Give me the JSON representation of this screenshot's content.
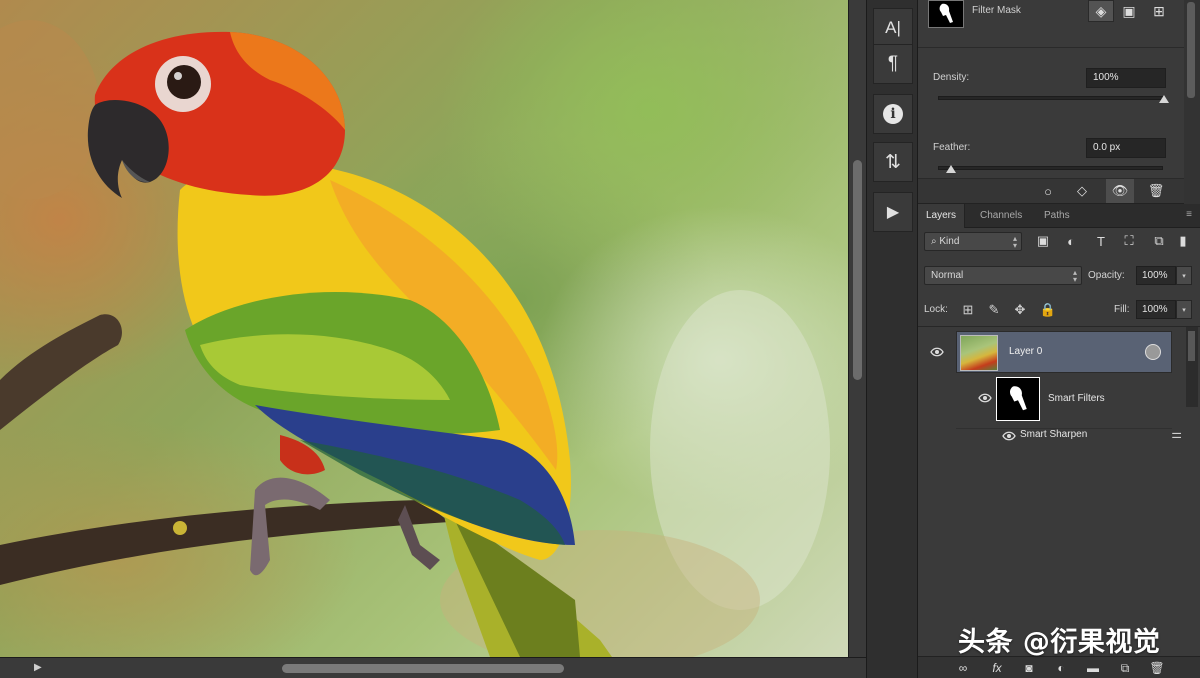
{
  "canvas": {
    "vertical_scroll": "scrollbar",
    "horizontal_scroll_arrow": "▶"
  },
  "toolstrip": {
    "tools": [
      {
        "name": "character-icon",
        "glyph": "A|"
      },
      {
        "name": "paragraph-icon",
        "glyph": "¶"
      },
      {
        "name": "info-icon",
        "glyph": "i"
      },
      {
        "name": "adjustments-icon",
        "glyph": "⇅"
      },
      {
        "name": "play-icon",
        "glyph": "▶"
      }
    ]
  },
  "properties": {
    "mask_label": "Filter Mask",
    "density_label": "Density:",
    "density_value": "100%",
    "density_level": 1.0,
    "feather_label": "Feather:",
    "feather_value": "0.0 px",
    "feather_level": 0.0
  },
  "layers_panel": {
    "tabs": [
      "Layers",
      "Channels",
      "Paths"
    ],
    "active_tab": "Layers",
    "filter_kind": "Kind",
    "blend_mode": "Normal",
    "opacity_label": "Opacity:",
    "opacity_value": "100%",
    "lock_label": "Lock:",
    "fill_label": "Fill:",
    "fill_value": "100%",
    "layers": [
      {
        "name": "Layer 0",
        "selected": true
      },
      {
        "name": "Smart Filters"
      },
      {
        "name": "Smart Sharpen"
      }
    ]
  },
  "watermark": "头条 @衍果视觉",
  "colors": {
    "panel_bg": "#3a3a3a",
    "selected_layer": "#596274",
    "field_bg": "#262626"
  }
}
